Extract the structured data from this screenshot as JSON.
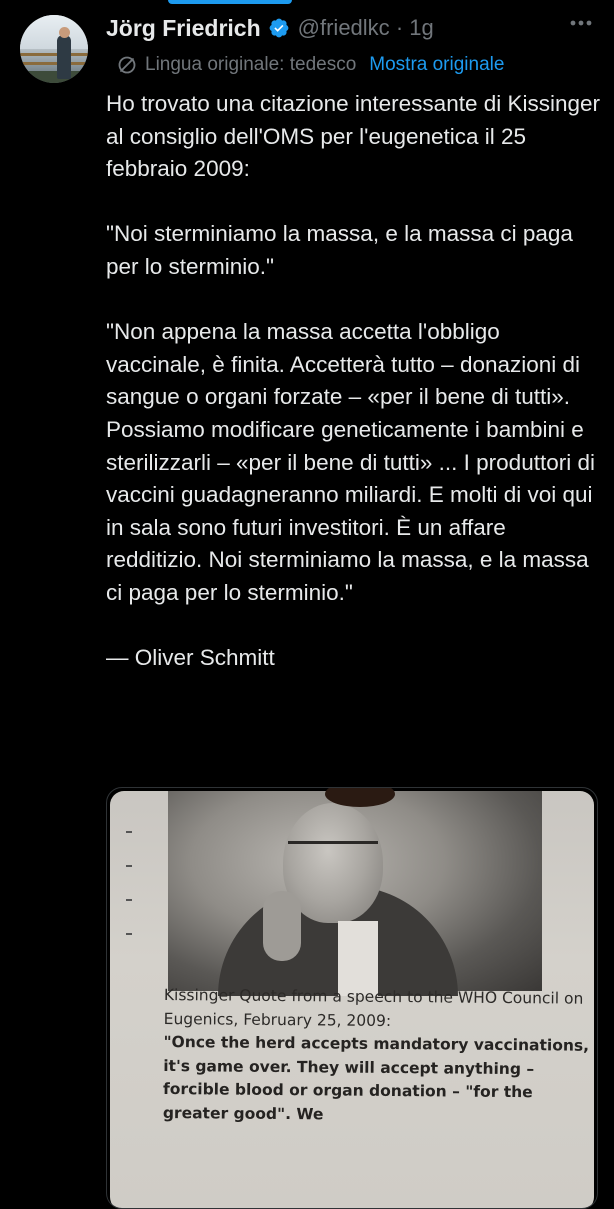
{
  "author": {
    "name": "Jörg Friedrich",
    "handle": "@friedlkc",
    "timestamp": "· 1g",
    "verified": true,
    "avatar_icon": "profile-photo"
  },
  "translation": {
    "original_language_label": "Lingua originale: tedesco",
    "show_original_label": "Mostra originale",
    "icon": "translate-icon"
  },
  "tweet": {
    "paragraphs": [
      "Ho trovato una citazione interessante di Kissinger al consiglio dell'OMS per l'eugenetica il 25 febbraio 2009:",
      "\"Noi sterminiamo la massa, e la massa ci paga per lo sterminio.\"",
      "\"Non appena la massa accetta l'obbligo vaccinale, è finita. Accetterà tutto – donazioni di sangue o organi forzate – «per il bene di tutti». Possiamo modificare geneticamente i bambini e sterilizzarli – «per il bene di tutti» ... I produttori di vaccini guadagneranno miliardi. E molti di voi qui in sala sono futuri investitori. È un affare redditizio. Noi sterminiamo la massa, e la massa ci paga per lo sterminio.\"",
      "— Oliver Schmitt"
    ]
  },
  "media": {
    "caption": "Kissinger Quote from a speech to the WHO Council on Eugenics, February 25, 2009:",
    "quote": "\"Once the herd accepts mandatory vaccinations, it's game over. They will accept anything – forcible blood or organ donation – \"for the greater good\". We"
  },
  "colors": {
    "background": "#000000",
    "text": "#e7e9ea",
    "muted": "#71767b",
    "accent": "#1d9bf0"
  }
}
